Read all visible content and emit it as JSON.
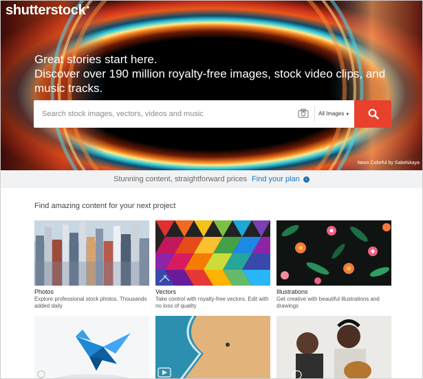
{
  "brand": {
    "logo_text": "shutterstock"
  },
  "hero": {
    "line1": "Great stories start here.",
    "line2": "Discover over 190 million royalty-free images, stock video clips, and music tracks.",
    "credit": "Neon Colorful by Sabelskaya"
  },
  "search": {
    "placeholder": "Search stock images, vectors, videos and music",
    "type_label": "All Images",
    "camera_icon": "camera-icon",
    "search_icon": "search-icon",
    "accent": "#e8412c"
  },
  "promo": {
    "text": "Stunning content, straightforward prices",
    "link": "Find your plan",
    "link_color": "#1a73b6"
  },
  "section": {
    "title": "Find amazing content for your next project"
  },
  "cards": [
    {
      "title": "Photos",
      "desc": "Explore professional stock photos. Thousands added daily"
    },
    {
      "title": "Vectors",
      "desc": "Take control with royalty-free vectors. Edit with no loss of quality"
    },
    {
      "title": "Illustrations",
      "desc": "Get creative with beautiful illustrations and drawings"
    }
  ]
}
